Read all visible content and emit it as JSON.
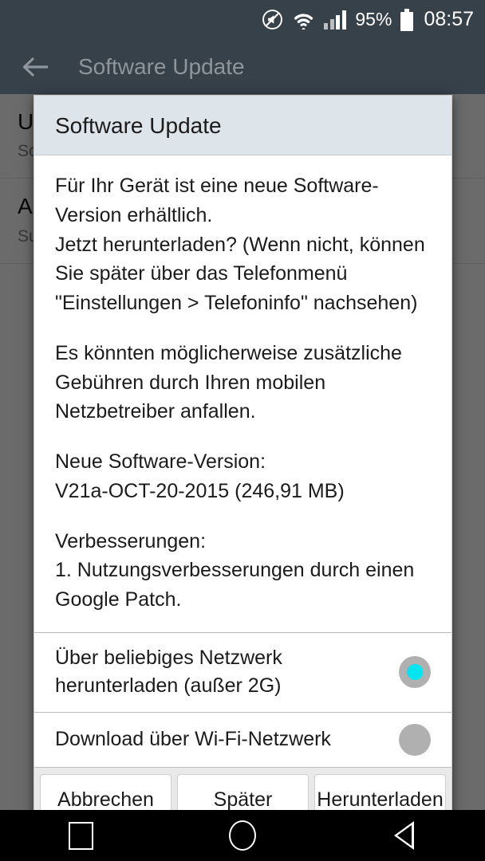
{
  "status_bar": {
    "mute_icon": "mute-icon",
    "wifi_icon": "wifi-icon",
    "signal_icon": "signal-bars-icon",
    "battery_percent": "95%",
    "battery_icon": "battery-icon",
    "time": "08:57"
  },
  "toolbar": {
    "back_icon": "back-arrow-icon",
    "title": "Software Update"
  },
  "background_page": {
    "rows": [
      {
        "title": "Update",
        "subtitle": "Software"
      },
      {
        "title": "Automatisch herunterladen",
        "subtitle": "Sucht automatisch nach\nund lädt neue\nSoftware herunter"
      }
    ]
  },
  "dialog": {
    "title": "Software Update",
    "paragraphs": [
      "Für Ihr Gerät ist eine neue Software-Version erhältlich.\nJetzt herunterladen? (Wenn nicht, können Sie später über das Telefonmenü \"Einstellungen > Telefoninfo\" nachsehen)",
      "Es könnten möglicherweise zusätzliche Gebühren durch Ihren mobilen Netzbetreiber anfallen.",
      "Neue Software-Version:\nV21a-OCT-20-2015 (246,91 MB)",
      "Verbesserungen:\n1. Nutzungsverbesserungen durch einen Google Patch."
    ],
    "options": [
      {
        "label": "Über beliebiges Netzwerk herunterladen (außer 2G)",
        "selected": true
      },
      {
        "label": "Download über Wi-Fi-Netzwerk",
        "selected": false
      }
    ],
    "buttons": [
      {
        "label": "Abbrechen"
      },
      {
        "label": "Später"
      },
      {
        "label": "Herunterladen"
      }
    ]
  },
  "nav_bar": {
    "recents_icon": "recents-square-icon",
    "home_icon": "home-circle-icon",
    "back_icon": "back-triangle-icon"
  },
  "colors": {
    "toolbar_bg": "#37414a",
    "dialog_header_bg": "#dde4ea",
    "radio_accent": "#00e5f0",
    "radio_track": "#b0b0b0",
    "button_bar_bg": "#e9e9e9"
  }
}
